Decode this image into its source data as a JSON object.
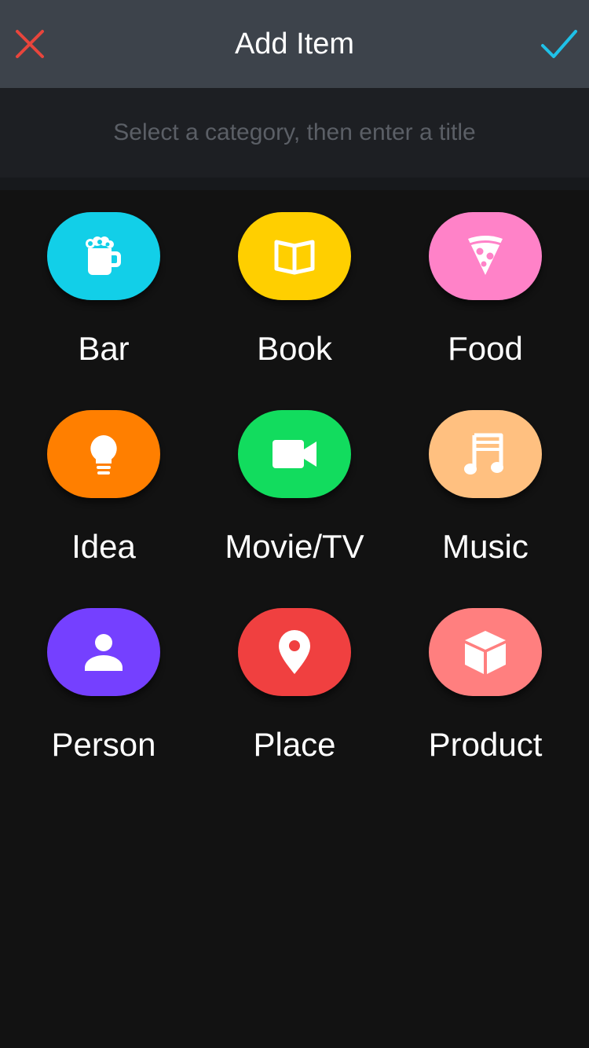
{
  "header": {
    "title": "Add Item",
    "close_icon": "close-icon",
    "done_icon": "checkmark-icon",
    "close_color": "#e8453c",
    "done_color": "#1fc1e8"
  },
  "title_input": {
    "placeholder": "Select a category, then enter a title",
    "value": ""
  },
  "categories": [
    {
      "label": "Bar",
      "icon": "beer-mug-icon",
      "color": "#12cfe8"
    },
    {
      "label": "Book",
      "icon": "open-book-icon",
      "color": "#ffcf00"
    },
    {
      "label": "Food",
      "icon": "pizza-slice-icon",
      "color": "#ff82c8"
    },
    {
      "label": "Idea",
      "icon": "lightbulb-icon",
      "color": "#ff7f00"
    },
    {
      "label": "Movie/TV",
      "icon": "video-camera-icon",
      "color": "#12dc5e"
    },
    {
      "label": "Music",
      "icon": "music-note-icon",
      "color": "#ffc080"
    },
    {
      "label": "Person",
      "icon": "person-icon",
      "color": "#7540ff"
    },
    {
      "label": "Place",
      "icon": "map-pin-icon",
      "color": "#f04040"
    },
    {
      "label": "Product",
      "icon": "cube-icon",
      "color": "#ff7f7f"
    }
  ]
}
